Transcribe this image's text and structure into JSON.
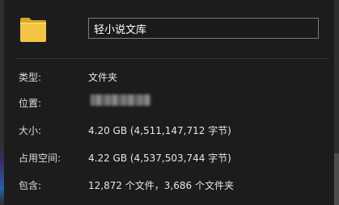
{
  "name_field": {
    "value": "轻小说文库"
  },
  "icons": {
    "folder": "folder-icon"
  },
  "properties": {
    "type": {
      "label": "类型:",
      "value": "文件夹"
    },
    "location": {
      "label": "位置:",
      "value": ""
    },
    "size": {
      "label": "大小:",
      "value": "4.20 GB (4,511,147,712 字节)"
    },
    "disk": {
      "label": "占用空间:",
      "value": "4.22 GB (4,537,503,744 字节)"
    },
    "contains": {
      "label": "包含:",
      "value": "12,872 个文件，3,686 个文件夹"
    }
  },
  "colors": {
    "background": "#1c1c1c",
    "folder": "#f0c040",
    "border": "#7a7a7a"
  }
}
